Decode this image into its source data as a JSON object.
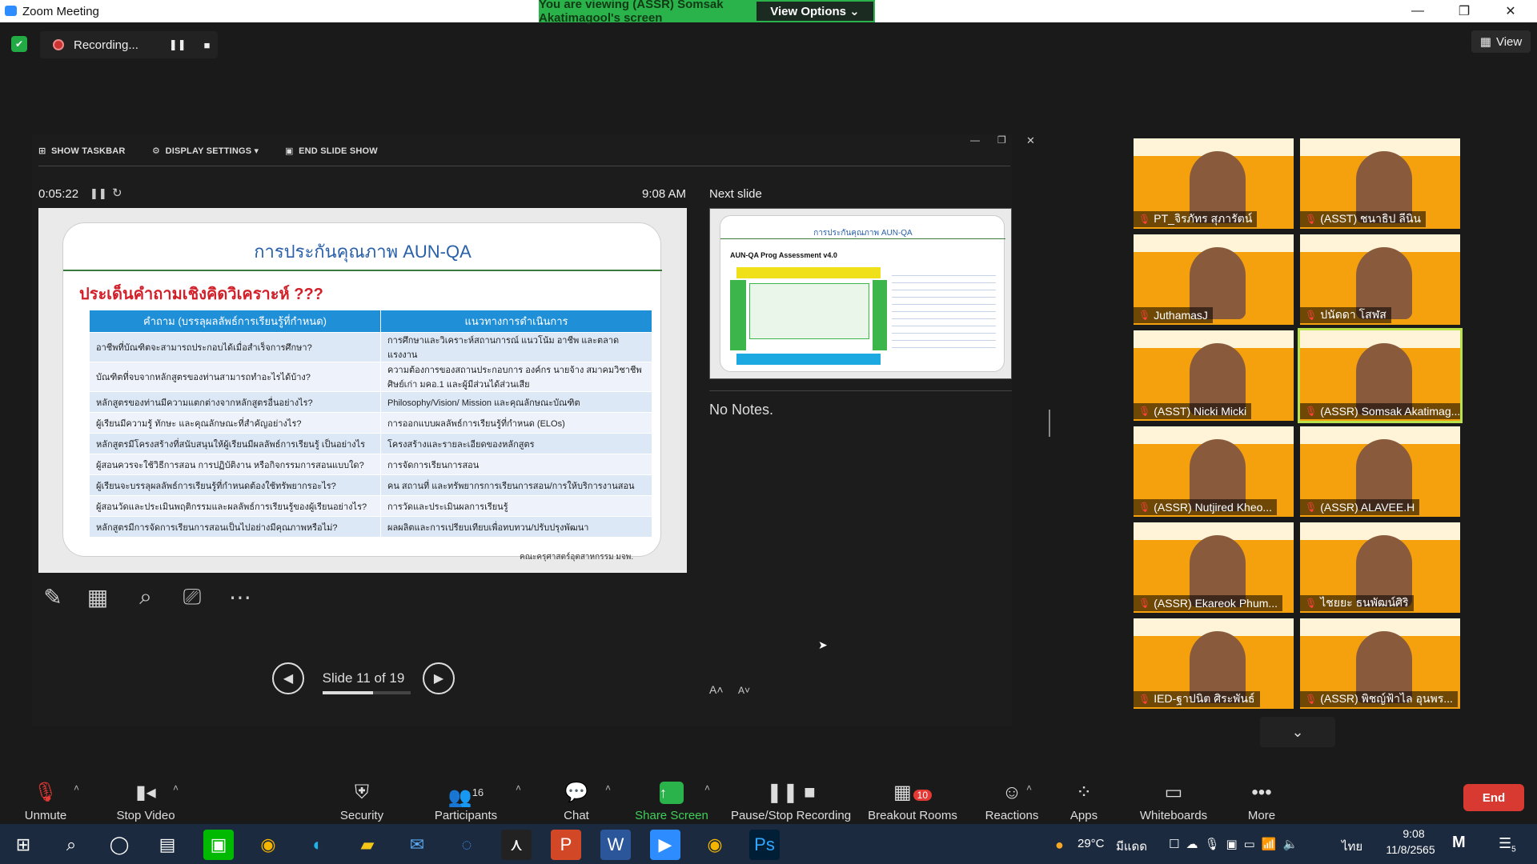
{
  "window": {
    "title": "Zoom Meeting"
  },
  "share_banner": {
    "message": "You are viewing (ASSR) Somsak Akatimagool's screen",
    "options_label": "View Options ⌄"
  },
  "recording": {
    "label": "Recording..."
  },
  "view_button": {
    "label": "View"
  },
  "presenter": {
    "show_taskbar": "SHOW TASKBAR",
    "display_settings": "DISPLAY SETTINGS ▾",
    "end_slide_show": "END SLIDE SHOW",
    "elapsed": "0:05:22",
    "clock": "9:08 AM",
    "next_slide_label": "Next slide",
    "notes": "No Notes.",
    "slide_counter": "Slide 11 of 19"
  },
  "slide": {
    "title": "การประกันคุณภาพ AUN-QA",
    "question": "ประเด็นคำถามเชิงคิดวิเคราะห์ ???",
    "col1_header": "คำถาม (บรรลุผลลัพธ์การเรียนรู้ที่กำหนด)",
    "col2_header": "แนวทางการดำเนินการ",
    "rows": [
      {
        "q": "อาชีพที่บัณฑิตจะสามารถประกอบได้เมื่อสำเร็จการศึกษา?",
        "a": "การศึกษาและวิเคราะห์สถานการณ์ แนวโน้ม อาชีพ และตลาดแรงงาน"
      },
      {
        "q": "บัณฑิตที่จบจากหลักสูตรของท่านสามารถทำอะไรได้บ้าง?",
        "a": "ความต้องการของสถานประกอบการ องค์กร นายจ้าง สมาคมวิชาชีพ ศิษย์เก่า มคอ.1 และผู้มีส่วนได้ส่วนเสีย"
      },
      {
        "q": "หลักสูตรของท่านมีความแตกต่างจากหลักสูตรอื่นอย่างไร?",
        "a": "Philosophy/Vision/ Mission และคุณลักษณะบัณฑิต"
      },
      {
        "q": "ผู้เรียนมีความรู้ ทักษะ และคุณลักษณะที่สำคัญอย่างไร?",
        "a": "การออกแบบผลลัพธ์การเรียนรู้ที่กำหนด (ELOs)"
      },
      {
        "q": "หลักสูตรมีโครงสร้างที่สนับสนุนให้ผู้เรียนมีผลลัพธ์การเรียนรู้ เป็นอย่างไร",
        "a": "โครงสร้างและรายละเอียดของหลักสูตร"
      },
      {
        "q": "ผู้สอนควรจะใช้วิธีการสอน การปฏิบัติงาน หรือกิจกรรมการสอนแบบใด?",
        "a": "การจัดการเรียนการสอน"
      },
      {
        "q": "ผู้เรียนจะบรรลุผลลัพธ์การเรียนรู้ที่กำหนดต้องใช้ทรัพยากรอะไร?",
        "a": "คน สถานที่ และทรัพยากรการเรียนการสอน/การให้บริการงานสอน"
      },
      {
        "q": "ผู้สอนวัดและประเมินพฤติกรรมและผลลัพธ์การเรียนรู้ของผู้เรียนอย่างไร?",
        "a": "การวัดและประเมินผลการเรียนรู้"
      },
      {
        "q": "หลักสูตรมีการจัดการเรียนการสอนเป็นไปอย่างมีคุณภาพหรือไม่?",
        "a": "ผลผลิตและการเปรียบเทียบเพื่อทบทวน/ปรับปรุงพัฒนา"
      }
    ],
    "credit": "คณะครุศาสตร์อุตสาหกรรม มจพ."
  },
  "next_slide": {
    "title": "การประกันคุณภาพ AUN-QA",
    "subtitle": "AUN-QA Prog Assessment v4.0"
  },
  "participants_gallery": [
    {
      "name": "PT_จิรภัทร สุภารัตน์"
    },
    {
      "name": "(ASST) ชนาธิป ลีนิน"
    },
    {
      "name": "JuthamasJ"
    },
    {
      "name": "ปนัดดา โสฬส"
    },
    {
      "name": "(ASST) Nicki Micki"
    },
    {
      "name": "(ASSR) Somsak Akatimag..."
    },
    {
      "name": "(ASSR) Nutjired Kheo..."
    },
    {
      "name": "(ASSR) ALAVEE.H"
    },
    {
      "name": "(ASSR) Ekareok Phum..."
    },
    {
      "name": "ไชยยะ ธนพัฒน์ศิริ"
    },
    {
      "name": "IED-ฐาปนิต ศิระพันธ์"
    },
    {
      "name": "(ASSR) พิชญ์ฟ้าไล อุนพร..."
    }
  ],
  "toolbar": {
    "unmute": "Unmute",
    "stop_video": "Stop Video",
    "security": "Security",
    "participants": "Participants",
    "participants_count": "16",
    "chat": "Chat",
    "share_screen": "Share Screen",
    "pause_stop": "Pause/Stop Recording",
    "breakout": "Breakout Rooms",
    "breakout_badge": "10",
    "reactions": "Reactions",
    "apps": "Apps",
    "whiteboards": "Whiteboards",
    "more": "More",
    "end": "End"
  },
  "taskbar": {
    "temp": "29°C",
    "weather": "มีแดด",
    "lang": "ไทย",
    "time": "9:08",
    "date": "11/8/2565",
    "notif": "5"
  }
}
